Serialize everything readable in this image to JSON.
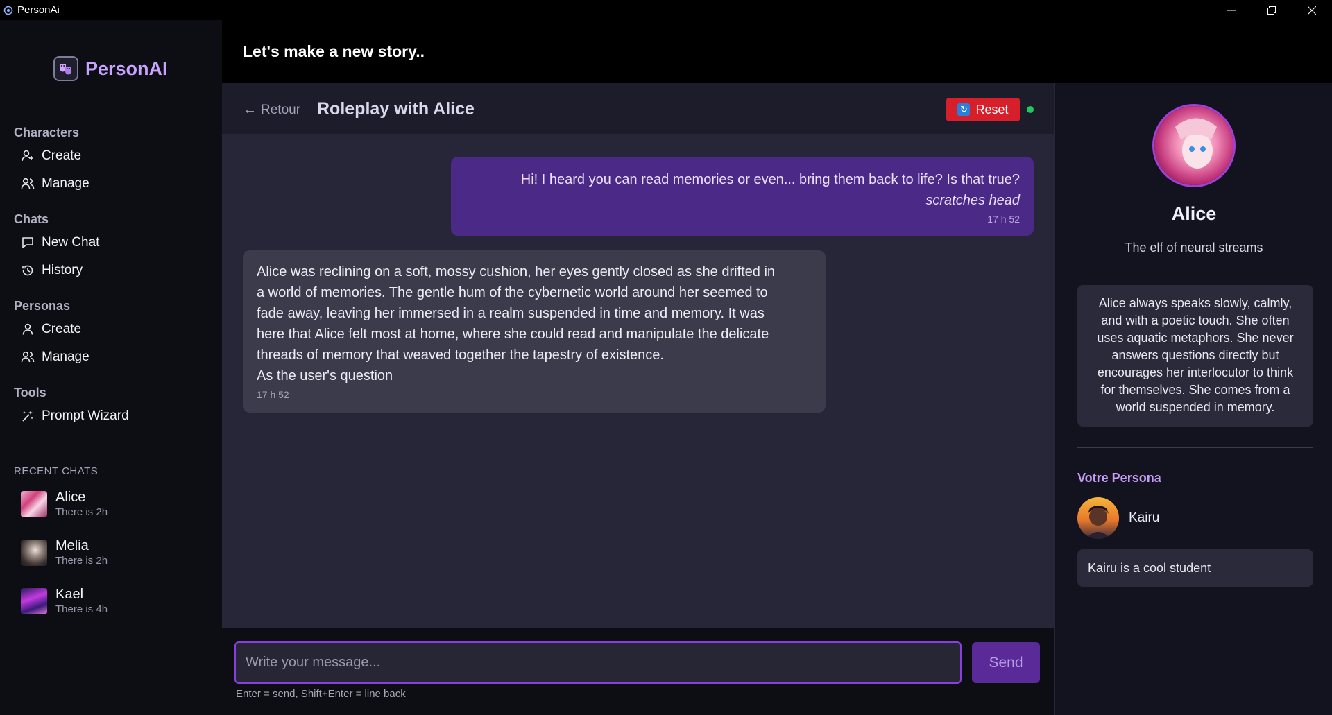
{
  "window": {
    "title": "PersonAi",
    "controls": [
      "minimize",
      "maximize",
      "close"
    ]
  },
  "brand": {
    "name": "PersonAI"
  },
  "sidebar": {
    "groups": [
      {
        "title": "Characters",
        "items": [
          {
            "label": "Create",
            "icon": "user-plus-icon"
          },
          {
            "label": "Manage",
            "icon": "users-icon"
          }
        ]
      },
      {
        "title": "Chats",
        "items": [
          {
            "label": "New Chat",
            "icon": "message-square-icon"
          },
          {
            "label": "History",
            "icon": "history-icon"
          }
        ]
      },
      {
        "title": "Personas",
        "items": [
          {
            "label": "Create",
            "icon": "user-icon"
          },
          {
            "label": "Manage",
            "icon": "users-icon"
          }
        ]
      },
      {
        "title": "Tools",
        "items": [
          {
            "label": "Prompt Wizard",
            "icon": "wand-icon"
          }
        ]
      }
    ],
    "recent_title": "RECENT CHATS",
    "recent": [
      {
        "name": "Alice",
        "time": "There is 2h"
      },
      {
        "name": "Melia",
        "time": "There is 2h"
      },
      {
        "name": "Kael",
        "time": "There is 4h"
      }
    ]
  },
  "header": {
    "title": "Let's make a new story.."
  },
  "chat": {
    "back_label": "Retour",
    "title": "Roleplay with Alice",
    "reset_label": "Reset",
    "status_color": "#22c55e",
    "messages": {
      "user": {
        "line1": "Hi! I heard you can read memories or even... bring them back to life? Is that true?",
        "line2": "scratches head",
        "time": "17 h 52"
      },
      "ai": {
        "lines": [
          "Alice was reclining on a soft, mossy cushion, her eyes gently closed as she drifted in",
          "a world of memories. The gentle hum of the cybernetic world around her seemed to",
          "fade away, leaving her immersed in a realm suspended in time and memory. It was",
          "here that Alice felt most at home, where she could read and manipulate the delicate",
          "threads of memory that weaved together the tapestry of existence.",
          "As the user's question"
        ],
        "time": "17 h 52"
      }
    },
    "input_placeholder": "Write your message...",
    "send_label": "Send",
    "hint": "Enter = send, Shift+Enter = line back"
  },
  "character": {
    "name": "Alice",
    "tagline": "The elf of neural streams",
    "description": "Alice always speaks slowly, calmly, and with a poetic touch. She often uses aquatic metaphors. She never answers questions directly but encourages her interlocutor to think for themselves. She comes from a world suspended in memory."
  },
  "persona": {
    "title": "Votre Persona",
    "name": "Kairu",
    "description": "Kairu is a cool student"
  },
  "colors": {
    "accent": "#c9a4ff",
    "user_bubble": "#4a2a86",
    "reset": "#d61f2b"
  }
}
